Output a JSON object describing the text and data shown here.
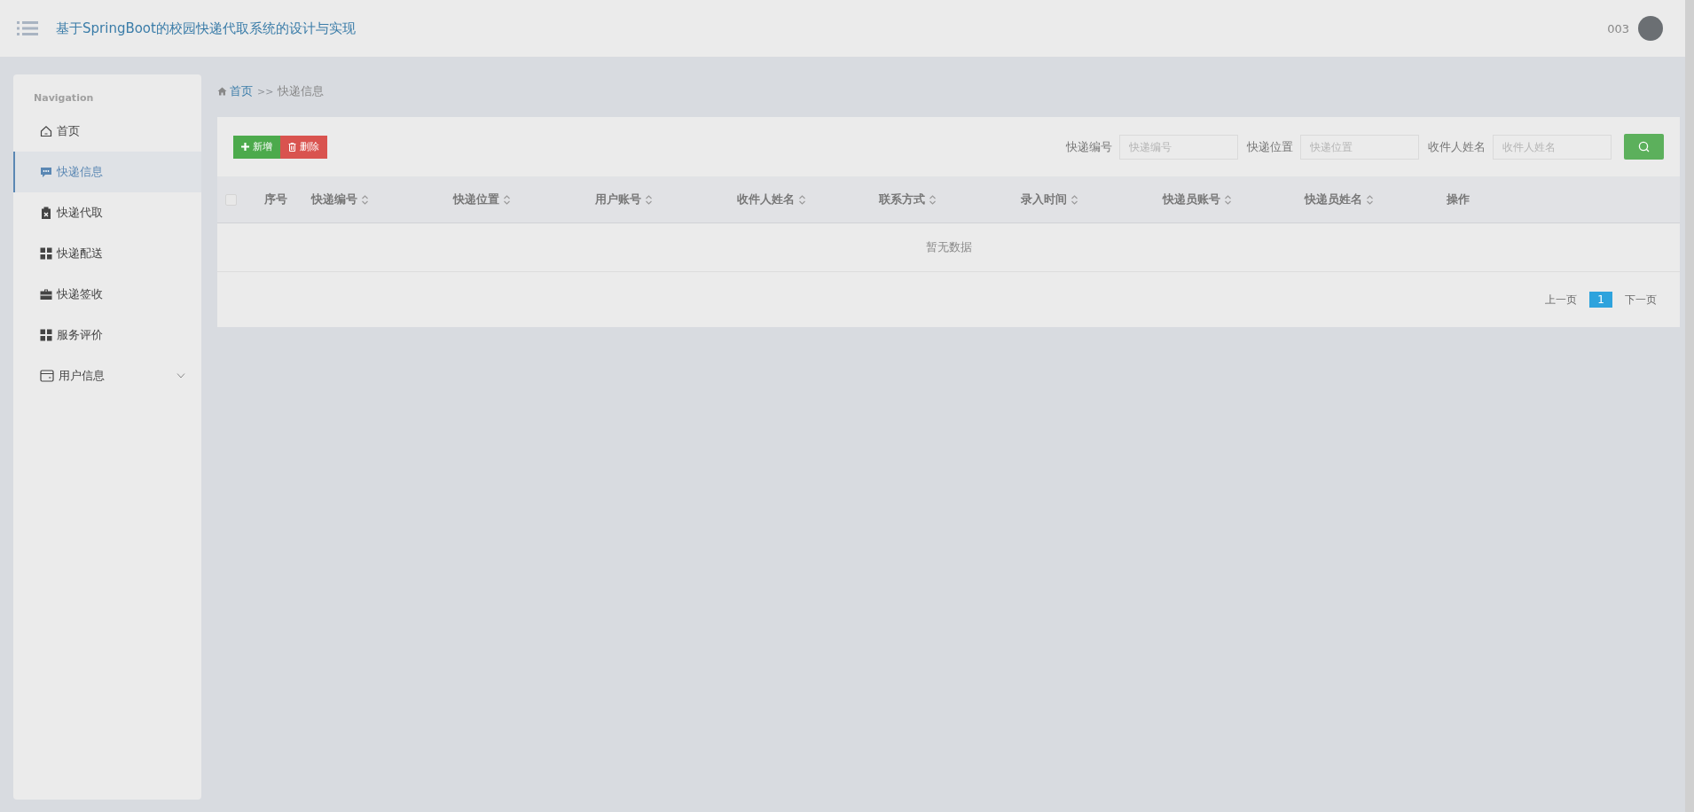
{
  "header": {
    "title": "基于SpringBoot的校园快递代取系统的设计与实现",
    "user": "003"
  },
  "sidebar": {
    "heading": "Navigation",
    "items": [
      {
        "label": "首页",
        "selected": false
      },
      {
        "label": "快递信息",
        "selected": true
      },
      {
        "label": "快递代取",
        "selected": false
      },
      {
        "label": "快递配送",
        "selected": false
      },
      {
        "label": "快递签收",
        "selected": false
      },
      {
        "label": "服务评价",
        "selected": false
      },
      {
        "label": "用户信息",
        "selected": false,
        "expanded": false
      }
    ]
  },
  "breadcrumb": {
    "home": "首页",
    "separator": ">>",
    "current": "快递信息"
  },
  "toolbar": {
    "add_button": "新增",
    "delete_button": "删除"
  },
  "search": {
    "fields": [
      {
        "label": "快递编号",
        "placeholder": "快递编号"
      },
      {
        "label": "快递位置",
        "placeholder": "快递位置"
      },
      {
        "label": "收件人姓名",
        "placeholder": "收件人姓名"
      }
    ]
  },
  "table": {
    "select_all_checked": false,
    "columns": [
      {
        "label": "序号",
        "sortable": false
      },
      {
        "label": "快递编号",
        "sortable": true
      },
      {
        "label": "快递位置",
        "sortable": true
      },
      {
        "label": "用户账号",
        "sortable": true
      },
      {
        "label": "收件人姓名",
        "sortable": true
      },
      {
        "label": "联系方式",
        "sortable": true
      },
      {
        "label": "录入时间",
        "sortable": true
      },
      {
        "label": "快递员账号",
        "sortable": true
      },
      {
        "label": "快递员姓名",
        "sortable": true
      },
      {
        "label": "操作",
        "sortable": false
      }
    ],
    "empty_text": "暂无数据"
  },
  "pagination": {
    "prev": "上一页",
    "pages": [
      {
        "label": "1",
        "selected": true
      }
    ],
    "next": "下一页"
  }
}
